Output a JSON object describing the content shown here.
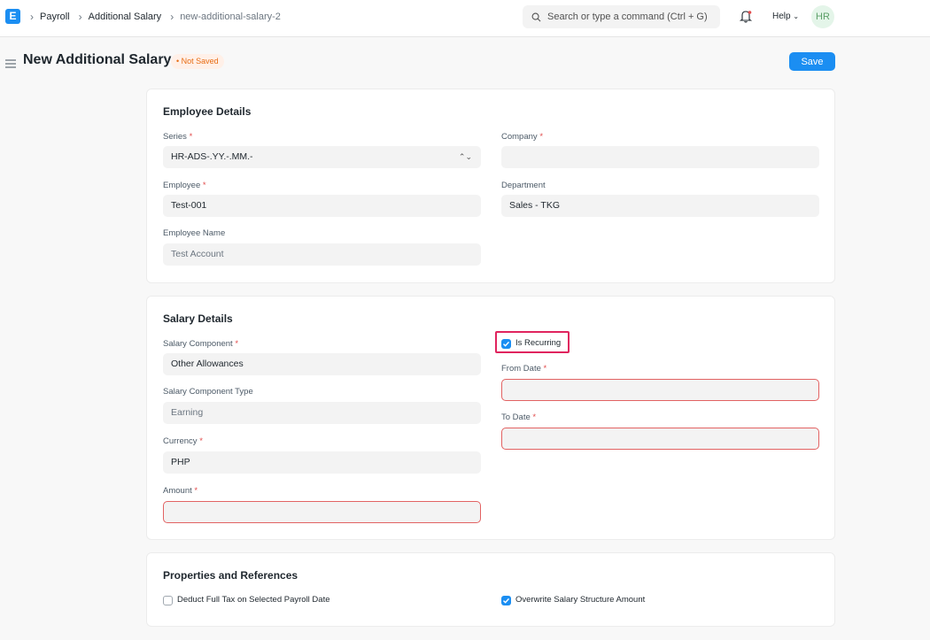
{
  "navbar": {
    "logo": "E",
    "breadcrumbs": [
      "Payroll",
      "Additional Salary",
      "new-additional-salary-2"
    ],
    "search_placeholder": "Search or type a command (Ctrl + G)",
    "help_label": "Help",
    "avatar_initials": "HR"
  },
  "page": {
    "title": "New Additional Salary",
    "status": "Not Saved",
    "save_label": "Save"
  },
  "employee_details": {
    "title": "Employee Details",
    "series_label": "Series",
    "series_value": "HR-ADS-.YY.-.MM.-",
    "company_label": "Company",
    "company_value": "",
    "employee_label": "Employee",
    "employee_value": "Test-001",
    "department_label": "Department",
    "department_value": "Sales - TKG",
    "employee_name_label": "Employee Name",
    "employee_name_value": "Test Account"
  },
  "salary_details": {
    "title": "Salary Details",
    "component_label": "Salary Component",
    "component_value": "Other Allowances",
    "component_type_label": "Salary Component Type",
    "component_type_value": "Earning",
    "currency_label": "Currency",
    "currency_value": "PHP",
    "amount_label": "Amount",
    "amount_value": "",
    "is_recurring_label": "Is Recurring",
    "is_recurring_checked": true,
    "from_date_label": "From Date",
    "from_date_value": "",
    "to_date_label": "To Date",
    "to_date_value": ""
  },
  "properties": {
    "title": "Properties and References",
    "deduct_full_tax_label": "Deduct Full Tax on Selected Payroll Date",
    "deduct_full_tax_checked": false,
    "overwrite_label": "Overwrite Salary Structure Amount",
    "overwrite_checked": true
  },
  "required_marker": "*",
  "colors": {
    "primary": "#1b8ef2",
    "error_border": "#e26262",
    "highlight": "#e0245e",
    "status": "#e86c13"
  }
}
